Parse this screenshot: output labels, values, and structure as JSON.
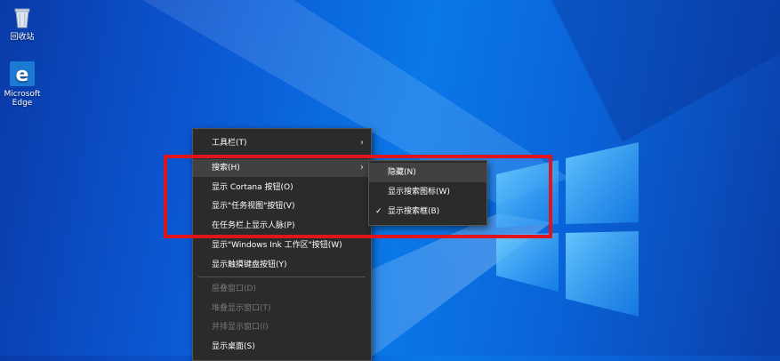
{
  "desktop": {
    "icons": [
      {
        "label": "回收站",
        "icon": "recycle-bin-icon"
      },
      {
        "label": "Microsoft Edge",
        "icon": "edge-icon"
      }
    ]
  },
  "context_menu": {
    "items": [
      {
        "label": "工具栏(T)",
        "has_submenu": true
      },
      {
        "label": "搜索(H)",
        "has_submenu": true,
        "highlighted": true
      },
      {
        "label": "显示 Cortana 按钮(O)"
      },
      {
        "label": "显示\"任务视图\"按钮(V)"
      },
      {
        "label": "在任务栏上显示人脉(P)"
      },
      {
        "label": "显示\"Windows Ink 工作区\"按钮(W)"
      },
      {
        "label": "显示触摸键盘按钮(Y)"
      },
      {
        "label": "层叠窗口(D)",
        "disabled": true
      },
      {
        "label": "堆叠显示窗口(T)",
        "disabled": true
      },
      {
        "label": "并排显示窗口(I)",
        "disabled": true
      },
      {
        "label": "显示桌面(S)"
      }
    ]
  },
  "search_submenu": {
    "items": [
      {
        "label": "隐藏(N)",
        "checked": false
      },
      {
        "label": "显示搜索图标(W)",
        "checked": false
      },
      {
        "label": "显示搜索框(B)",
        "checked": true
      }
    ],
    "check_glyph": "✓"
  },
  "colors": {
    "highlight_box": "#e0141c",
    "menu_background": "#2b2b2b"
  }
}
